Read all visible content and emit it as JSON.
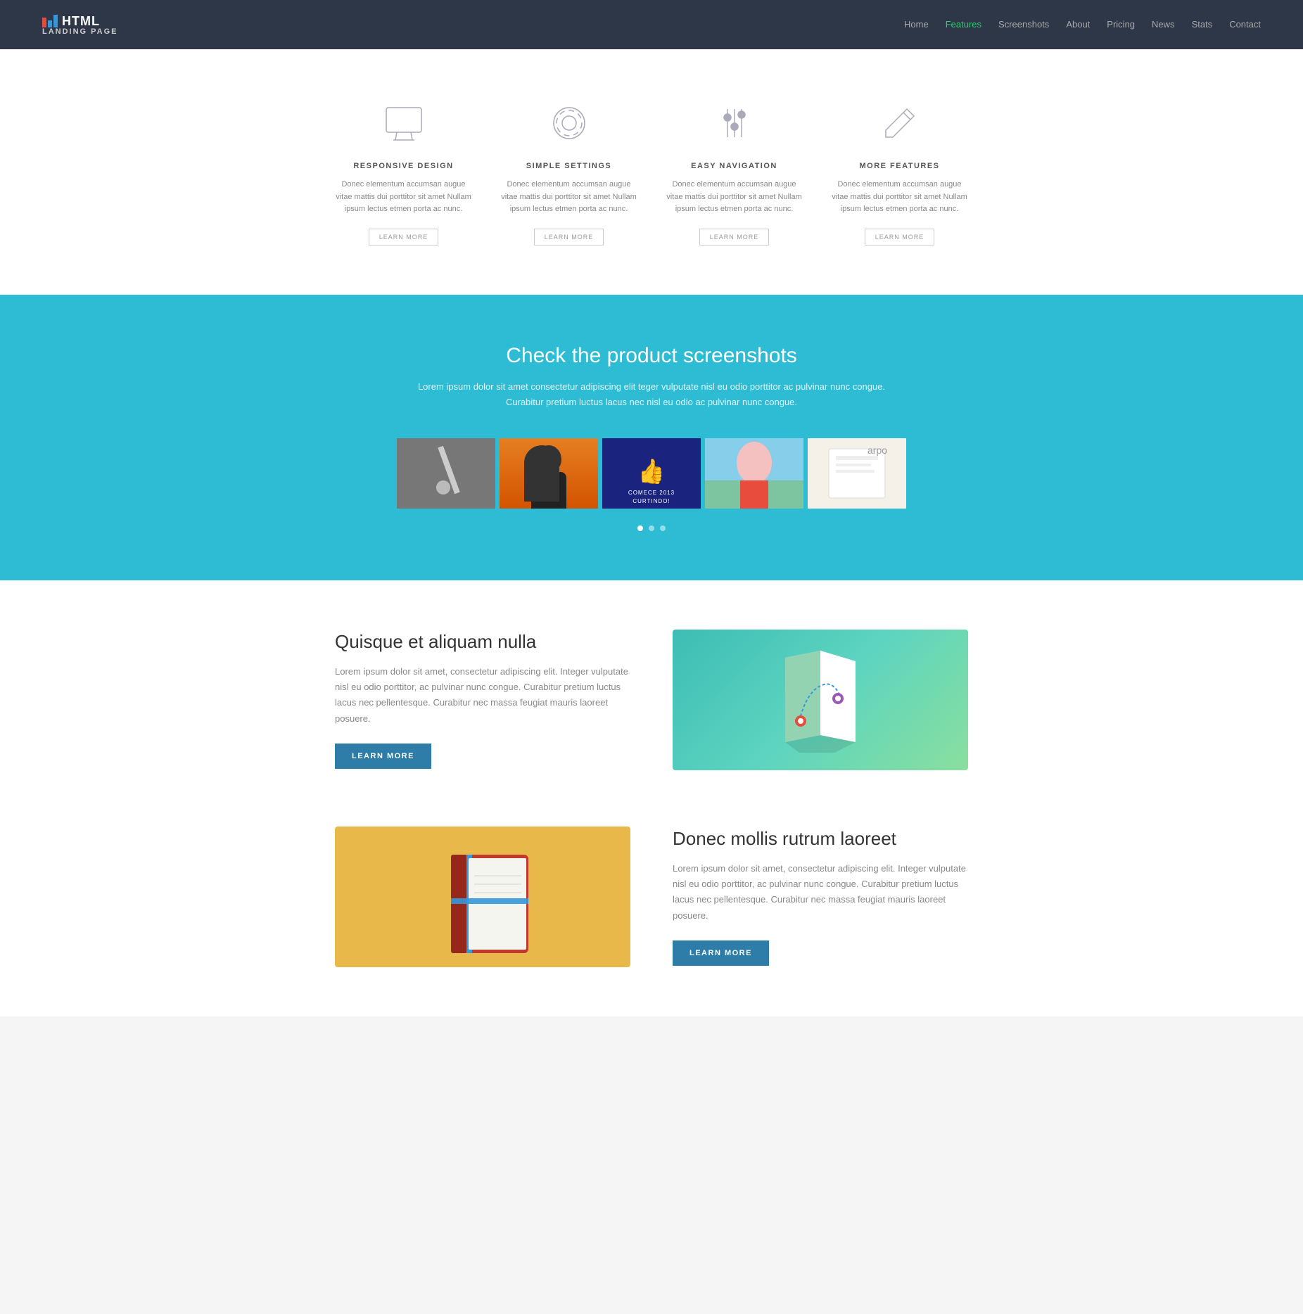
{
  "navbar": {
    "brand": "HTML",
    "brand_subtitle": "LANDING PAGE",
    "nav_items": [
      {
        "label": "Home",
        "active": false
      },
      {
        "label": "Features",
        "active": true
      },
      {
        "label": "Screenshots",
        "active": false
      },
      {
        "label": "About",
        "active": false
      },
      {
        "label": "Pricing",
        "active": false
      },
      {
        "label": "News",
        "active": false
      },
      {
        "label": "Stats",
        "active": false
      },
      {
        "label": "Contact",
        "active": false
      }
    ]
  },
  "features": {
    "items": [
      {
        "icon": "monitor",
        "title": "RESPONSIVE DESIGN",
        "desc": "Donec elementum accumsan augue vitae mattis dui porttitor sit amet Nullam ipsum lectus etmen porta ac nunc.",
        "button_label": "LEARN MORE"
      },
      {
        "icon": "settings",
        "title": "SIMPLE SETTINGS",
        "desc": "Donec elementum accumsan augue vitae mattis dui porttitor sit amet Nullam ipsum lectus etmen porta ac nunc.",
        "button_label": "LEARN MORE"
      },
      {
        "icon": "sliders",
        "title": "EASY NAVIGATION",
        "desc": "Donec elementum accumsan augue vitae mattis dui porttitor sit amet Nullam ipsum lectus etmen porta ac nunc.",
        "button_label": "LEARN MORE"
      },
      {
        "icon": "pencil",
        "title": "MORE FEATURES",
        "desc": "Donec elementum accumsan augue vitae mattis dui porttitor sit amet Nullam ipsum lectus etmen porta ac nunc.",
        "button_label": "LEARN MORE"
      }
    ]
  },
  "screenshots": {
    "title": "Check the product screenshots",
    "desc_line1": "Lorem ipsum dolor sit amet consectetur adipiscing elit teger vulputate nisl eu odio porttitor ac pulvinar nunc congue.",
    "desc_line2": "Curabitur pretium luctus lacus nec nisl eu odio ac pulvinar nunc congue.",
    "carousel_dots": 3,
    "active_dot": 0
  },
  "about": {
    "section1": {
      "title": "Quisque et aliquam nulla",
      "desc": "Lorem ipsum dolor sit amet, consectetur adipiscing elit. Integer vulputate nisl eu odio porttitor, ac pulvinar nunc congue. Curabitur pretium luctus lacus nec pellentesque. Curabitur nec massa feugiat mauris laoreet posuere.",
      "button_label": "LEARN MORE"
    },
    "section2": {
      "title": "Donec mollis rutrum laoreet",
      "desc": "Lorem ipsum dolor sit amet, consectetur adipiscing elit. Integer vulputate nisl eu odio porttitor, ac pulvinar nunc congue. Curabitur pretium luctus lacus nec pellentesque. Curabitur nec massa feugiat mauris laoreet posuere.",
      "button_label": "LEARN MORE"
    }
  },
  "colors": {
    "navbar_bg": "#2d3748",
    "accent_teal": "#2dbcd4",
    "accent_blue": "#2d7da8",
    "active_nav": "#2ecc71"
  }
}
